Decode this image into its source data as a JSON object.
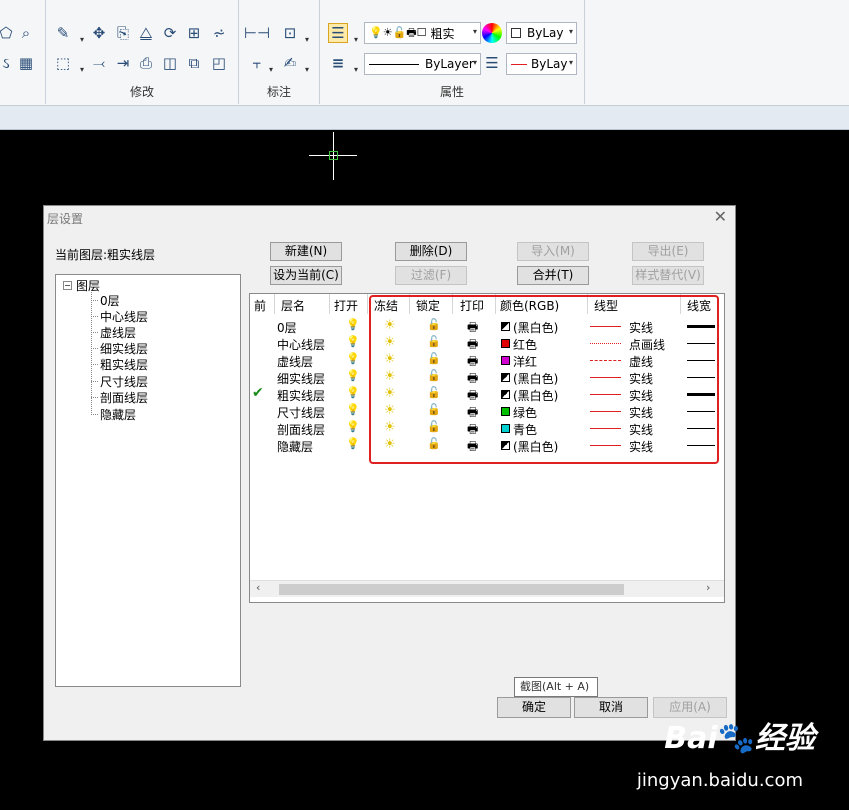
{
  "ribbon": {
    "group_modify": "修改",
    "group_dimension": "标注",
    "group_properties": "属性",
    "layer_combo_value": "粗实",
    "color_combo_value": "ByLay",
    "linetype_combo_value": "ByLayer",
    "lineweight_combo_value": "ByLay"
  },
  "dialog": {
    "title": "层设置",
    "current_layer_label": "当前图层:粗实线层",
    "tree": {
      "root": "图层",
      "items": [
        "0层",
        "中心线层",
        "虚线层",
        "细实线层",
        "粗实线层",
        "尺寸线层",
        "剖面线层",
        "隐藏层"
      ]
    },
    "buttons": {
      "new": "新建(N)",
      "delete": "删除(D)",
      "import": "导入(M)",
      "export": "导出(E)",
      "set_current": "设为当前(C)",
      "filter": "过滤(F)",
      "merge": "合并(T)",
      "style_replace": "样式替代(V)",
      "ok": "确定",
      "cancel": "取消",
      "apply": "应用(A)"
    },
    "columns": [
      "前",
      "层名",
      "打开",
      "冻结",
      "锁定",
      "打印",
      "颜色(RGB)",
      "线型",
      "线宽"
    ],
    "rows": [
      {
        "name": "0层",
        "current": false,
        "on": true,
        "color_name": "(黑白色)",
        "color_hex": "bw",
        "linetype": "实线",
        "lt_style": "solid",
        "thick": true
      },
      {
        "name": "中心线层",
        "current": false,
        "on": true,
        "color_name": "红色",
        "color_hex": "#e00000",
        "linetype": "点画线",
        "lt_style": "dashdot",
        "thick": false
      },
      {
        "name": "虚线层",
        "current": false,
        "on": true,
        "color_name": "洋红",
        "color_hex": "#d000d0",
        "linetype": "虚线",
        "lt_style": "dashed",
        "thick": false
      },
      {
        "name": "细实线层",
        "current": false,
        "on": true,
        "color_name": "(黑白色)",
        "color_hex": "bw",
        "linetype": "实线",
        "lt_style": "solid",
        "thick": false
      },
      {
        "name": "粗实线层",
        "current": true,
        "on": true,
        "color_name": "(黑白色)",
        "color_hex": "bw",
        "linetype": "实线",
        "lt_style": "solid",
        "thick": true
      },
      {
        "name": "尺寸线层",
        "current": false,
        "on": true,
        "color_name": "绿色",
        "color_hex": "#00c000",
        "linetype": "实线",
        "lt_style": "solid",
        "thick": false
      },
      {
        "name": "剖面线层",
        "current": false,
        "on": true,
        "color_name": "青色",
        "color_hex": "#00d0d0",
        "linetype": "实线",
        "lt_style": "solid",
        "thick": false
      },
      {
        "name": "隐藏层",
        "current": false,
        "on": false,
        "color_name": "(黑白色)",
        "color_hex": "bw",
        "linetype": "实线",
        "lt_style": "solid",
        "thick": false
      }
    ]
  },
  "tooltip": "截图(Alt + A)",
  "watermark": {
    "logo": "Bai经验",
    "url": "jingyan.baidu.com"
  }
}
